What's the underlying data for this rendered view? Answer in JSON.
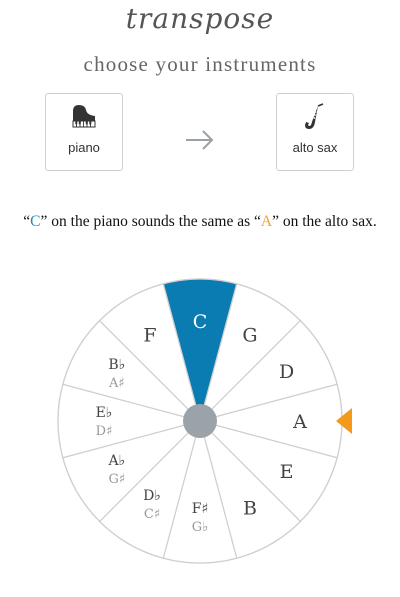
{
  "app": {
    "title": "transpose",
    "subtitle": "choose your instruments"
  },
  "instruments": {
    "source": {
      "label": "piano",
      "icon": "piano-icon"
    },
    "target": {
      "label": "alto sax",
      "icon": "saxophone-icon"
    },
    "arrow_icon": "arrow-right-icon"
  },
  "result": {
    "q1": "“",
    "source_note": "C",
    "mid1": "” on the piano sounds the same as “",
    "target_note": "A",
    "end": "” on the alto sax."
  },
  "wheel": {
    "notes": [
      {
        "primary": "C",
        "secondary": ""
      },
      {
        "primary": "G",
        "secondary": ""
      },
      {
        "primary": "D",
        "secondary": ""
      },
      {
        "primary": "A",
        "secondary": ""
      },
      {
        "primary": "E",
        "secondary": ""
      },
      {
        "primary": "B",
        "secondary": ""
      },
      {
        "primary": "F♯",
        "secondary": "G♭"
      },
      {
        "primary": "D♭",
        "secondary": "C♯"
      },
      {
        "primary": "A♭",
        "secondary": "G♯"
      },
      {
        "primary": "E♭",
        "secondary": "D♯"
      },
      {
        "primary": "B♭",
        "secondary": "A♯"
      },
      {
        "primary": "F",
        "secondary": ""
      }
    ],
    "selected_index": 0,
    "target_index": 3
  },
  "colors": {
    "selected_fill": "#0a7cb1",
    "marker": "#f39a1c",
    "line": "#cfcfcf",
    "hub": "#9ca3a8"
  }
}
